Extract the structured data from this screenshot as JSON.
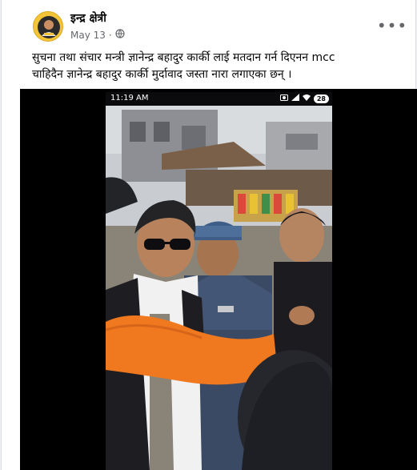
{
  "post": {
    "author_name": "इन्द्र क्षेत्री",
    "date": "May 13",
    "date_separator": "·",
    "privacy_icon": "globe-icon",
    "more_label": "•••",
    "text_lines": [
      "सुचना तथा संचार मन्त्री ज्ञानेन्द्र बहादुर कार्की लाई मतदान गर्न दिएनन mcc",
      "चाहिदैन ज्ञानेन्द्र बहादुर कार्की मुर्दावाद जस्ता नारा लगाएका छन् ।"
    ]
  },
  "video": {
    "status_time": "11:19 AM",
    "battery": "28",
    "signal_icons": [
      "camera-icon",
      "wifi-icon",
      "signal-icon"
    ]
  },
  "colors": {
    "page_bg": "#f0f2f5",
    "card_bg": "#ffffff",
    "text_primary": "#050505",
    "text_secondary": "#65676b",
    "avatar_bg": "#f3c437",
    "video_bg": "#000000",
    "jacket_orange": "#f0781e"
  }
}
